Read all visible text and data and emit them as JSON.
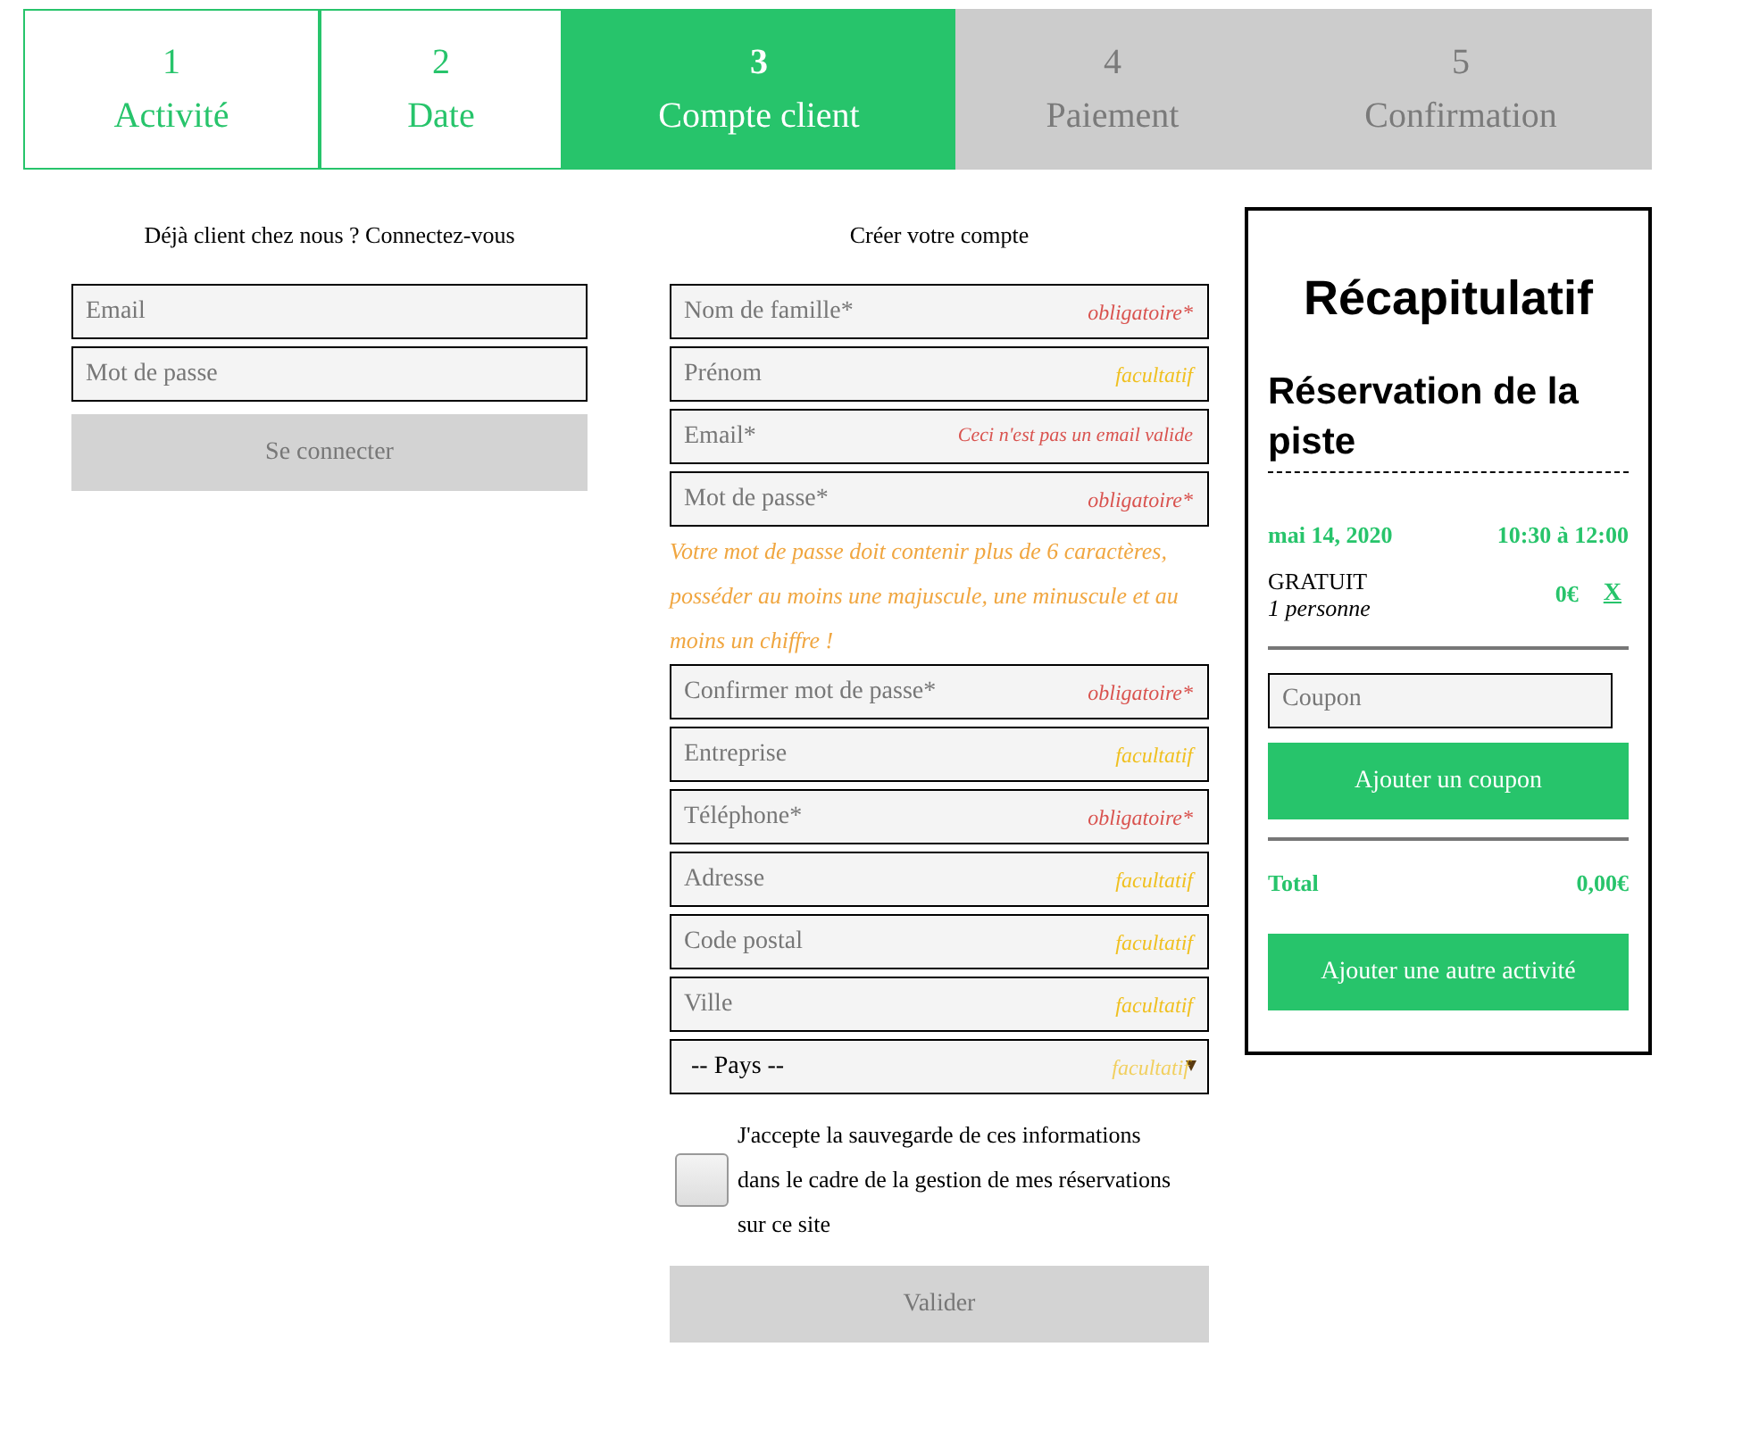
{
  "steps": [
    {
      "number": "1",
      "label": "Activité",
      "completed": true,
      "selected": false
    },
    {
      "number": "2",
      "label": "Date",
      "completed": true,
      "selected": false
    },
    {
      "number": "3",
      "label": "Compte client",
      "completed": false,
      "selected": true
    },
    {
      "number": "4",
      "label": "Paiement",
      "completed": false,
      "selected": false
    },
    {
      "number": "5",
      "label": "Confirmation",
      "completed": false,
      "selected": false
    }
  ],
  "login": {
    "heading": "Déjà client chez nous ? Connectez-vous",
    "fields": [
      {
        "placeholder": "Email"
      },
      {
        "placeholder": "Mot de passe"
      }
    ],
    "button": {
      "label": "Se connecter",
      "disabled": true
    }
  },
  "register": {
    "heading": "Créer votre compte",
    "fields": [
      {
        "kind": "text",
        "placeholder": "Nom de famille*",
        "hint": {
          "kind": "required",
          "text": "obligatoire*"
        }
      },
      {
        "kind": "text",
        "placeholder": "Prénom",
        "hint": {
          "kind": "optional",
          "text": "facultatif"
        }
      },
      {
        "kind": "text",
        "placeholder": "Email*",
        "hint": {
          "kind": "error",
          "text": "Ceci n'est pas un email valide"
        }
      },
      {
        "kind": "text",
        "placeholder": "Mot de passe*",
        "hint": {
          "kind": "required",
          "text": "obligatoire*"
        }
      },
      {
        "kind": "note",
        "text": "Votre mot de passe doit contenir plus de 6 caractères, posséder au moins une majuscule, une minuscule et au moins un chiffre !"
      },
      {
        "kind": "text",
        "placeholder": "Confirmer mot de passe*",
        "hint": {
          "kind": "required",
          "text": "obligatoire*"
        }
      },
      {
        "kind": "text",
        "placeholder": "Entreprise",
        "hint": {
          "kind": "optional",
          "text": "facultatif"
        }
      },
      {
        "kind": "text",
        "placeholder": "Téléphone*",
        "hint": {
          "kind": "required",
          "text": "obligatoire*"
        }
      },
      {
        "kind": "text",
        "placeholder": "Adresse",
        "hint": {
          "kind": "optional",
          "text": "facultatif"
        }
      },
      {
        "kind": "text",
        "placeholder": "Code postal",
        "hint": {
          "kind": "optional",
          "text": "facultatif"
        }
      },
      {
        "kind": "text",
        "placeholder": "Ville",
        "hint": {
          "kind": "optional",
          "text": "facultatif"
        }
      },
      {
        "kind": "select",
        "value": "-- Pays --",
        "hint": {
          "kind": "optional",
          "text": "facultatif"
        }
      }
    ],
    "consent": {
      "checked": false,
      "label": "J'accepte la sauvegarde de ces informations dans le cadre de la gestion de mes réservations sur ce site"
    },
    "button": {
      "label": "Valider",
      "disabled": true
    }
  },
  "summary": {
    "title": "Récapitulatif",
    "activity": "Réservation de la piste",
    "date": "mai 14, 2020",
    "time": "10:30 à 12:00",
    "rate": "GRATUIT",
    "people": "1 personne",
    "price": "0€",
    "remove": "X",
    "coupon_placeholder": "Coupon",
    "coupon_button": "Ajouter un coupon",
    "total_label": "Total",
    "total": "0,00€",
    "add_button": "Ajouter une autre activité"
  }
}
